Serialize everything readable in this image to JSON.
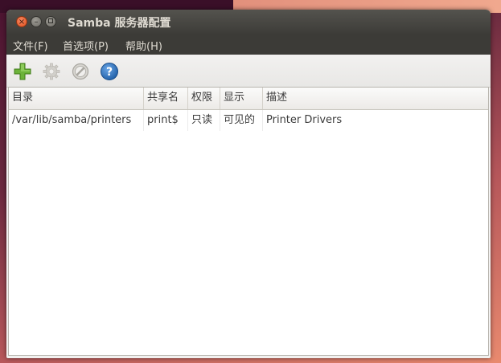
{
  "window": {
    "title": "Samba 服务器配置"
  },
  "menubar": {
    "items": [
      "文件(F)",
      "首选项(P)",
      "帮助(H)"
    ]
  },
  "toolbar": {
    "buttons": [
      {
        "icon": "add-icon",
        "enabled": true,
        "color": "#5aa02c"
      },
      {
        "icon": "gear-icon",
        "enabled": false,
        "color": "#c9c7c2"
      },
      {
        "icon": "delete-icon",
        "enabled": false,
        "color": "#b0aea8"
      },
      {
        "icon": "help-icon",
        "enabled": true,
        "color": "#2f6fb5"
      }
    ]
  },
  "table": {
    "columns": [
      "目录",
      "共享名",
      "权限",
      "显示",
      "描述"
    ],
    "rows": [
      [
        "/var/lib/samba/printers",
        "print$",
        "只读",
        "可见的",
        "Printer Drivers"
      ]
    ]
  },
  "colors": {
    "title_bar": "#3d3c38",
    "menubar": "#3c3b37",
    "close_button": "#e0511e",
    "window_bg": "#f2f1f0"
  }
}
